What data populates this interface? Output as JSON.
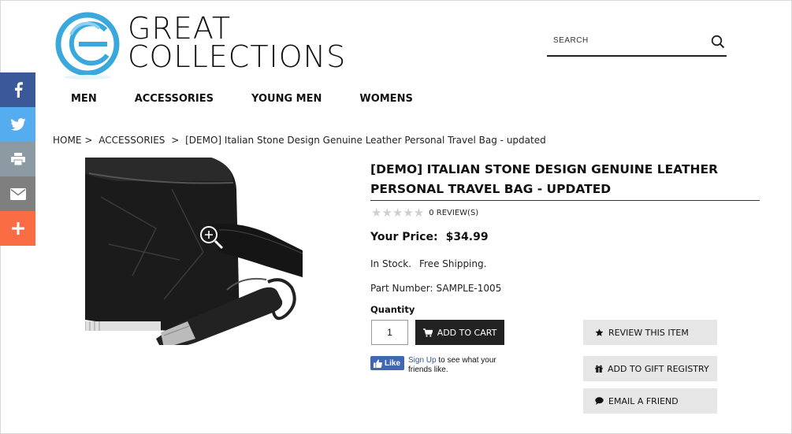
{
  "brand": {
    "line1": "GREAT",
    "line2": "COLLECTIONS",
    "accent": "#3aa8dc"
  },
  "search": {
    "placeholder": "SEARCH"
  },
  "nav": {
    "items": [
      {
        "label": "MEN"
      },
      {
        "label": "ACCESSORIES"
      },
      {
        "label": "YOUNG MEN"
      },
      {
        "label": "WOMENS"
      }
    ]
  },
  "social": {
    "items": [
      "facebook-icon",
      "twitter-icon",
      "print-icon",
      "email-icon",
      "plus-icon"
    ],
    "colors": [
      "#3b5998",
      "#55acee",
      "#8b9aa3",
      "#7f7f7f",
      "#f96c44"
    ]
  },
  "breadcrumb": {
    "home": "HOME",
    "sep1": ">",
    "category": "ACCESSORIES",
    "sep2": ">",
    "current": "[DEMO] Italian Stone Design Genuine Leather Personal Travel Bag - updated"
  },
  "product": {
    "title": "[DEMO] ITALIAN STONE DESIGN GENUINE LEATHER PERSONAL TRAVEL BAG - UPDATED",
    "stars": "★★★★★",
    "reviews": "0 REVIEW(S)",
    "price_label": "Your Price:",
    "price": "$34.99",
    "stock": "In Stock.",
    "shipping": "Free Shipping.",
    "part_label": "Part Number:",
    "part_number": "SAMPLE-1005",
    "quantity_label": "Quantity",
    "quantity": "1",
    "add_to_cart": "ADD TO CART"
  },
  "facebook": {
    "like": "Like",
    "signup": "Sign Up",
    "text": " to see what your friends like."
  },
  "actions": {
    "review": "REVIEW THIS ITEM",
    "gift": "ADD TO GIFT REGISTRY",
    "email": "EMAIL A FRIEND"
  }
}
